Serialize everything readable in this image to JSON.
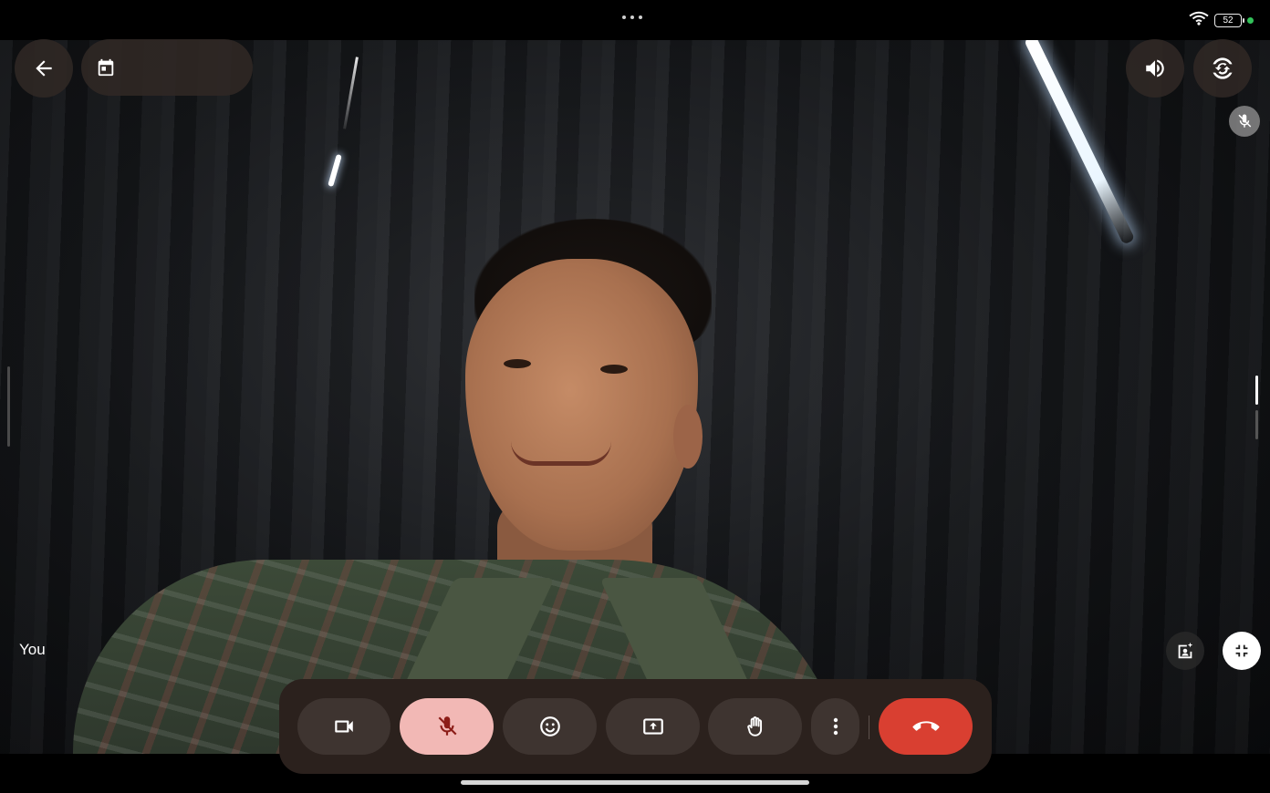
{
  "status": {
    "battery": "52",
    "icons": [
      "wifi-icon",
      "battery-icon",
      "privacy-indicator"
    ]
  },
  "top_bar": {
    "back_icon": "arrow-back-icon",
    "meeting_info_icon": "calendar-icon",
    "meeting_info_text": "",
    "speaker_icon": "volume-icon",
    "flip_icon": "switch-camera-icon"
  },
  "video": {
    "self_label": "You",
    "self_muted": true
  },
  "controls": {
    "camera": "videocam-icon",
    "mic": "mic-off-icon",
    "emoji": "emoji-icon",
    "present": "present-screen-icon",
    "raise_hand": "hand-icon",
    "more": "more-vert-icon",
    "end_call": "call-end-icon"
  },
  "colors": {
    "control_bar": "#2b211d",
    "button_bg": "#3e3430",
    "mic_off_bg": "#f2b8b5",
    "mic_off_icon": "#8c1d18",
    "end_call": "#d93f31",
    "privacy_dot": "#33c25a"
  }
}
